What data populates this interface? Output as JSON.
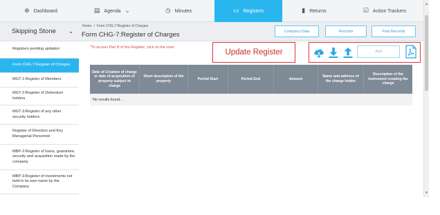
{
  "nav": {
    "items": [
      {
        "label": "Dashboard",
        "icon": "dashboard-icon",
        "glyph": "⊕"
      },
      {
        "label": "Agenda",
        "icon": "agenda-icon",
        "glyph": "▤",
        "caret": "⌄"
      },
      {
        "label": "Minutes",
        "icon": "clock-icon",
        "glyph": "◷"
      },
      {
        "label": "Registers",
        "icon": "folder-icon",
        "glyph": "▭",
        "active": true
      },
      {
        "label": "Returns",
        "icon": "document-icon",
        "glyph": "▮"
      },
      {
        "label": "Action Trackers",
        "icon": "tracker-icon",
        "glyph": "☑"
      }
    ],
    "accent": "#29b6ef"
  },
  "company": {
    "name": "Skipping Stone",
    "caret": "⌄"
  },
  "sidebar": {
    "items": [
      {
        "label": "Registers pending updation"
      },
      {
        "label": "Form CHG-7:Register of Charges",
        "active": true
      },
      {
        "label": "MGT-1:Register of Members"
      },
      {
        "label": "MGT-2:Register of Debenture holders"
      },
      {
        "label": "MGT-3:Register of any other security holders"
      },
      {
        "label": "Register of Directors and Key Managerial Personnel"
      },
      {
        "label": "MBP-2:Register of loans, guarantee, security and acquisition made by the company"
      },
      {
        "label": "MBP-3:Register of investments not held in its own name by the Company"
      }
    ]
  },
  "header": {
    "breadcrumb": {
      "home": "Home",
      "separator": "/",
      "current": "Form CHG-7:Register of Charges"
    },
    "title": "Form CHG-7:Register of Charges",
    "buttons": {
      "company_data": "Company Data",
      "records": "Records",
      "past_records": "Past Records"
    }
  },
  "notice": "*To access Part B of the Register, click on the rows",
  "update_label": "Update Register",
  "actions": {
    "cloud_icon": "cloud-download-icon",
    "download_icon": "download-icon",
    "upload_icon": "upload-icon",
    "add_label": "Add",
    "pdf_icon": "pdf-icon",
    "icon_color": "#29a7e6"
  },
  "table": {
    "columns": [
      "Date of Creation of charge or date of acquisition of property subject to charge",
      "Short description of the property",
      "Period Start",
      "Period End",
      "Amount",
      "Name and address of the charge holder",
      "Description of the instrument creating the charge"
    ],
    "empty_text": "No results found..."
  }
}
